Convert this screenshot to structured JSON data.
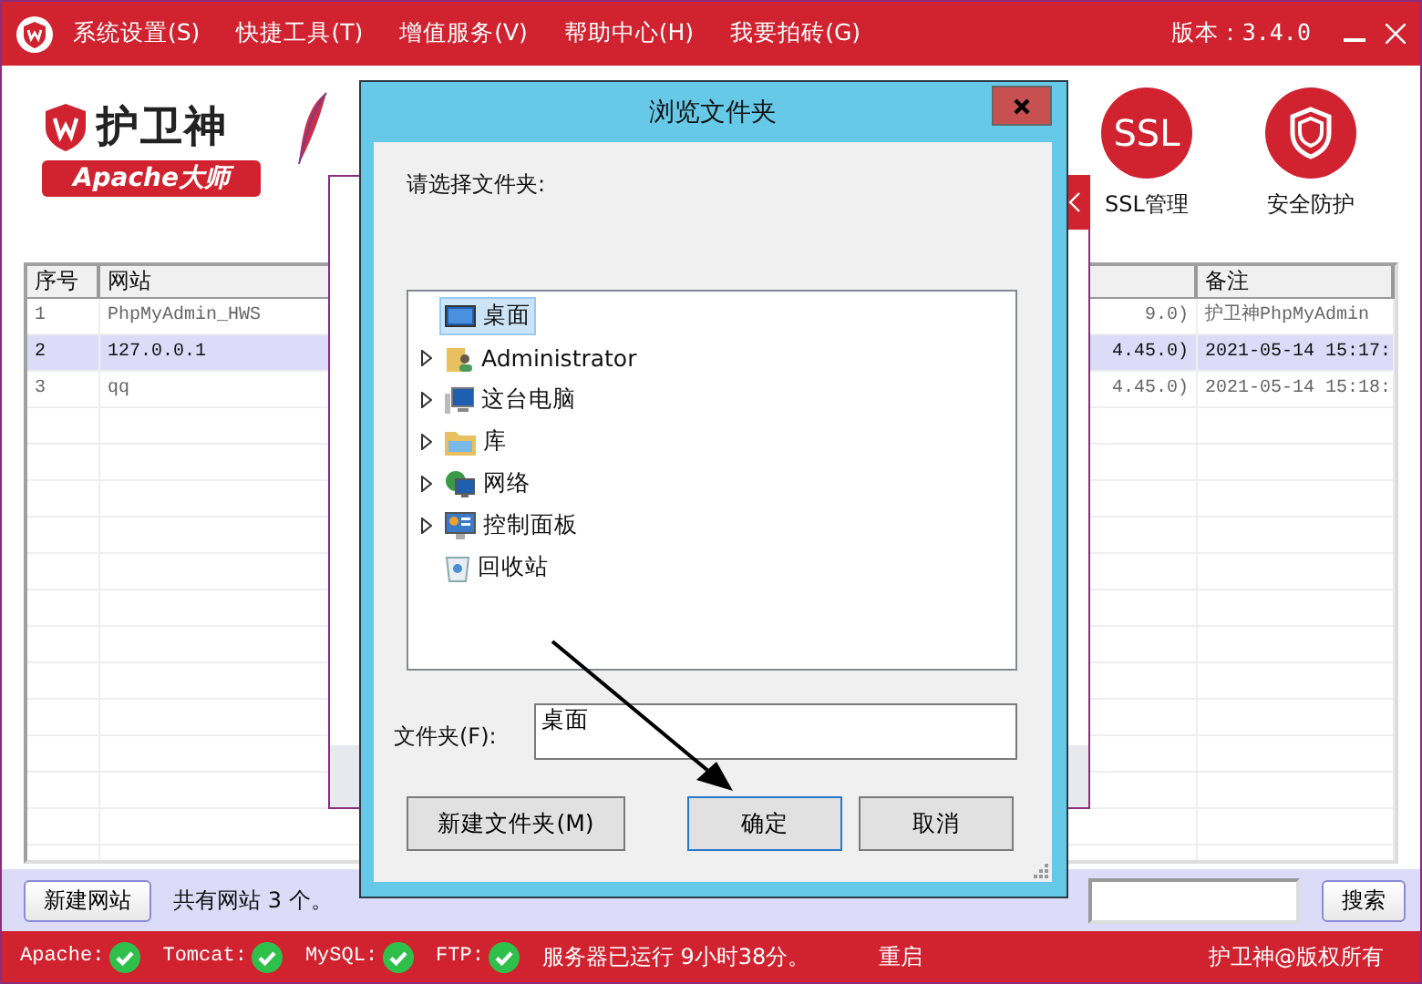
{
  "main_window": {
    "menu": [
      "系统设置(S)",
      "快捷工具(T)",
      "增值服务(V)",
      "帮助中心(H)",
      "我要拍砖(G)"
    ],
    "version": "版本：3.4.0"
  },
  "brand": {
    "name": "护卫神",
    "tagline": "Apache大师"
  },
  "tools": [
    {
      "kind": "ssl",
      "badge": "SSL",
      "label": "SSL管理"
    },
    {
      "kind": "shield",
      "label": "安全防护"
    }
  ],
  "table": {
    "columns": [
      "序号",
      "网站",
      "备注"
    ],
    "rows": [
      {
        "index": "1",
        "site": "PhpMyAdmin_HWS",
        "column_3": "9.0)",
        "note": "护卫神PhpMyAdmin",
        "selected": false
      },
      {
        "index": "2",
        "site": "127.0.0.1",
        "column_3": "4.45.0)",
        "note": "2021-05-14 15:17:",
        "selected": true
      },
      {
        "index": "3",
        "site": "qq",
        "column_3": "4.45.0)",
        "note": "2021-05-14 15:18:",
        "selected": false
      }
    ]
  },
  "bottom_bar": {
    "new_site_button": "新建网站",
    "count_text": "共有网站 3 个。",
    "search_button": "搜索"
  },
  "status_bar": {
    "services": [
      {
        "name": "Apache:",
        "running": true
      },
      {
        "name": "Tomcat:",
        "running": true
      },
      {
        "name": "MySQL:",
        "running": true
      },
      {
        "name": "FTP:",
        "running": true
      }
    ],
    "uptime": "服务器已运行 9小时38分。",
    "restart": "重启",
    "copyright": "护卫神@版权所有"
  },
  "dialog": {
    "title": "浏览文件夹",
    "prompt": "请选择文件夹:",
    "tree": [
      {
        "label": "桌面",
        "kind": "desktop",
        "selected": true,
        "expandable": false
      },
      {
        "label": "Administrator",
        "kind": "user",
        "selected": false,
        "expandable": true
      },
      {
        "label": "这台电脑",
        "kind": "computer",
        "selected": false,
        "expandable": true
      },
      {
        "label": "库",
        "kind": "library",
        "selected": false,
        "expandable": true
      },
      {
        "label": "网络",
        "kind": "network",
        "selected": false,
        "expandable": true
      },
      {
        "label": "控制面板",
        "kind": "control",
        "selected": false,
        "expandable": true
      },
      {
        "label": "回收站",
        "kind": "recycle",
        "selected": false,
        "expandable": false
      }
    ],
    "folder_label": "文件夹(F):",
    "folder_value": "桌面",
    "buttons": [
      {
        "label": "新建文件夹(M)",
        "focused": false
      },
      {
        "label": "确定",
        "focused": true
      },
      {
        "label": "取消",
        "focused": false
      }
    ]
  }
}
